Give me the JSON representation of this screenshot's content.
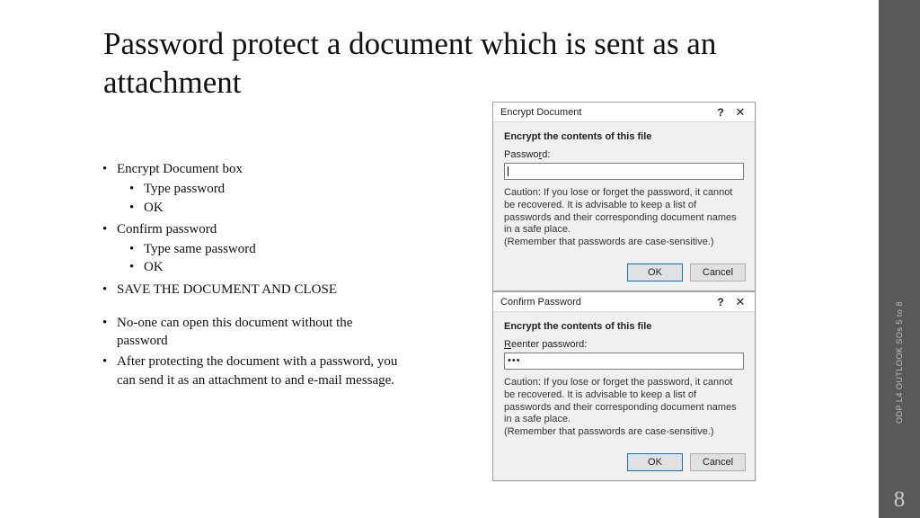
{
  "sidebar": {
    "label": "ODP L4 OUTLOOK SOs 5 to 8",
    "page_number": "8"
  },
  "title": "Password protect a document which is sent as an attachment",
  "outline": {
    "items": [
      {
        "text": "Encrypt Document box",
        "children": [
          "Type password",
          "OK"
        ]
      },
      {
        "text": "Confirm password",
        "children": [
          "Type same password",
          "OK"
        ]
      },
      {
        "text": "SAVE THE DOCUMENT AND CLOSE",
        "children": []
      }
    ],
    "after_gap": [
      "No-one can open this document without the password",
      "After protecting the document with a password, you can send it as an attachment to and e-mail message."
    ]
  },
  "dialog_common": {
    "heading": "Encrypt the contents of this file",
    "caution": "Caution: If you lose or forget the password, it cannot be recovered. It is advisable to keep a list of passwords and their corresponding document names in a safe place.",
    "remember": "(Remember that passwords are case-sensitive.)",
    "ok": "OK",
    "cancel": "Cancel",
    "help": "?",
    "close": "✕"
  },
  "dialog1": {
    "title": "Encrypt Document",
    "label_full": "Password:",
    "label_ul": "r",
    "label_pre": "Passwo",
    "label_post": "d:",
    "input_value": ""
  },
  "dialog2": {
    "title": "Confirm Password",
    "label_full": "Reenter password:",
    "label_ul": "R",
    "label_pre": "",
    "label_post": "eenter password:",
    "input_value": "•••"
  }
}
